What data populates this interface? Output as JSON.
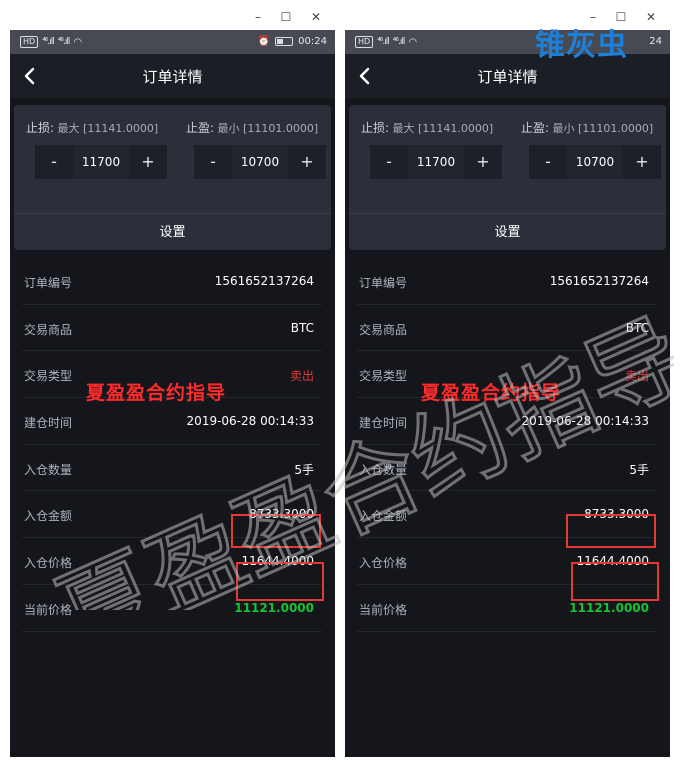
{
  "window": {
    "minimize": "–",
    "maximize": "☐",
    "close": "✕"
  },
  "statusbar": {
    "hd": "HD",
    "sig1": "⁴⁶.ıll",
    "sig2": "⁴⁶.ıll",
    "time": "00:24",
    "time_partial": "24"
  },
  "nav": {
    "title": "订单详情",
    "back_icon": "chevron-left-icon"
  },
  "card": {
    "stop_loss_label": "止损:",
    "stop_loss_hint": "最大 [11141.0000]",
    "take_profit_label": "止盈:",
    "take_profit_hint": "最小 [11101.0000]",
    "minus": "-",
    "plus": "+",
    "stop_loss_value": "11700",
    "take_profit_value": "10700",
    "set_label": "设置"
  },
  "details": [
    {
      "key": "订单编号",
      "value": "1561652137264"
    },
    {
      "key": "交易商品",
      "value": "BTC"
    },
    {
      "key": "交易类型",
      "value": "卖出"
    },
    {
      "key": "建仓时间",
      "value": "2019-06-28 00:14:33"
    },
    {
      "key": "入仓数量",
      "value": "5手"
    },
    {
      "key": "入仓金额",
      "value": "8733.3000"
    },
    {
      "key": "入仓价格",
      "value": "11644.4000"
    },
    {
      "key": "当前价格",
      "value": "11121.0000"
    }
  ],
  "overlay_text": "夏盈盈合约指导",
  "watermark_text": "夏盈盈合约指导",
  "brand_text": "锥灰虫",
  "colors": {
    "sell": "#e53935",
    "current_price": "#18c231",
    "highlight_box": "#e53935",
    "brand": "#1e7fd8"
  }
}
